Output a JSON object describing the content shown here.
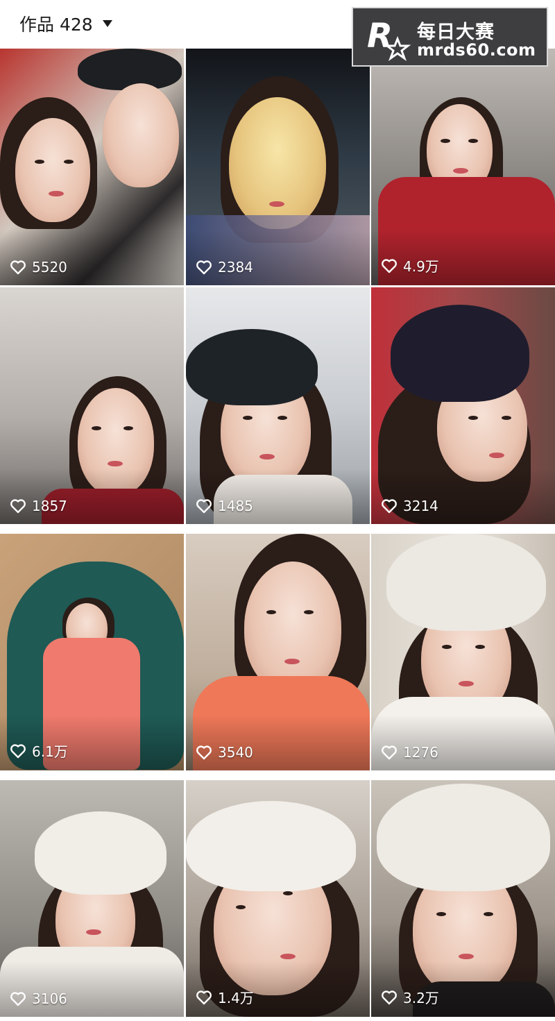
{
  "header": {
    "title": "作品 428",
    "dropdown_icon": "caret-down-icon"
  },
  "watermark": {
    "logo_icon": "r-star-logo",
    "name": "每日大赛",
    "url": "mrds60.com"
  },
  "heart_icon": "heart-outline-icon",
  "videos": [
    {
      "likes": "5520"
    },
    {
      "likes": "2384"
    },
    {
      "likes": "4.9万"
    },
    {
      "likes": "1857"
    },
    {
      "likes": "1485"
    },
    {
      "likes": "3214"
    },
    {
      "likes": "6.1万"
    },
    {
      "likes": "3540"
    },
    {
      "likes": "1276"
    },
    {
      "likes": "3106"
    },
    {
      "likes": "1.4万"
    },
    {
      "likes": "3.2万"
    }
  ]
}
